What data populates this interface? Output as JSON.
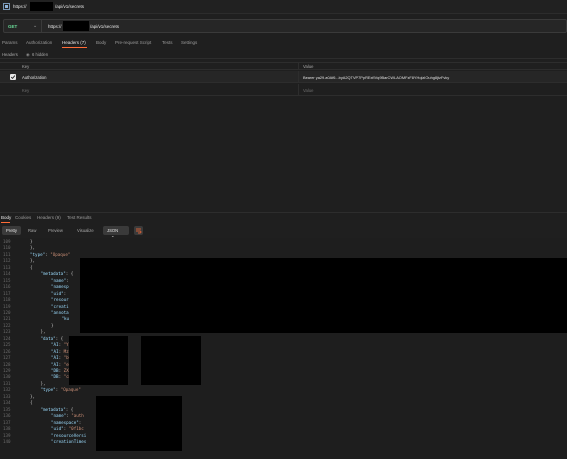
{
  "window": {
    "title_prefix": "https://",
    "title_suffix": "/api/v1/secrets"
  },
  "request": {
    "method": "GET",
    "url_prefix": "https://",
    "url_suffix": "/api/v1/secrets"
  },
  "request_tabs": [
    {
      "label": "Params"
    },
    {
      "label": "Authorization"
    },
    {
      "label": "Headers (7)"
    },
    {
      "label": "Body"
    },
    {
      "label": "Pre-request Script"
    },
    {
      "label": "Tests"
    },
    {
      "label": "Settings"
    }
  ],
  "headers_sub": {
    "label": "Headers",
    "hidden_label": "6 hidden"
  },
  "kv_table": {
    "key_header": "Key",
    "value_header": "Value",
    "rows": [
      {
        "key": "Authorization",
        "value": "Bearer ya29.a0Af6...byA2QTVP7PpRExfIVq9BarCWLAOMFzF8YHqlzIOuhg8jtzFvky"
      }
    ],
    "placeholder_key": "Key",
    "placeholder_value": "Value"
  },
  "response_tabs": [
    {
      "label": "Body"
    },
    {
      "label": "Cookies"
    },
    {
      "label": "Headers (9)"
    },
    {
      "label": "Test Results"
    }
  ],
  "format_tabs": [
    {
      "label": "Pretty"
    },
    {
      "label": "Raw"
    },
    {
      "label": "Preview"
    },
    {
      "label": "Visualize"
    }
  ],
  "format_select": "JSON",
  "code_lines": [
    {
      "n": "109",
      "indent": 0,
      "text": "}"
    },
    {
      "n": "110",
      "indent": 0,
      "text": "},"
    },
    {
      "n": "111",
      "indent": 0,
      "k": "\"type\"",
      "v": "\"Opaque\""
    },
    {
      "n": "112",
      "indent": 0,
      "text": "},"
    },
    {
      "n": "113",
      "indent": 0,
      "text": "{"
    },
    {
      "n": "114",
      "indent": 1,
      "k": "\"metadata\"",
      "text": ": {"
    },
    {
      "n": "115",
      "indent": 2,
      "k": "\"name\"",
      "text": ":"
    },
    {
      "n": "116",
      "indent": 2,
      "k": "\"namesp",
      "text": ""
    },
    {
      "n": "117",
      "indent": 2,
      "k": "\"uid\"",
      "text": ":"
    },
    {
      "n": "118",
      "indent": 2,
      "k": "\"resour",
      "text": ""
    },
    {
      "n": "119",
      "indent": 2,
      "k": "\"creati",
      "text": ""
    },
    {
      "n": "120",
      "indent": 2,
      "k": "\"annota",
      "text": ""
    },
    {
      "n": "121",
      "indent": 3,
      "k": "\"ku",
      "text": ""
    },
    {
      "n": "122",
      "indent": 2,
      "text": "}"
    },
    {
      "n": "123",
      "indent": 1,
      "text": "},"
    },
    {
      "n": "124",
      "indent": 1,
      "k": "\"data\"",
      "text": ": {"
    },
    {
      "n": "125",
      "indent": 2,
      "k": "\"AI",
      "v": "\"Y2"
    },
    {
      "n": "126",
      "indent": 2,
      "k": "\"AI",
      "v": "MzB"
    },
    {
      "n": "127",
      "indent": 2,
      "k": "\"AI",
      "v": "\"bU"
    },
    {
      "n": "128",
      "indent": 2,
      "k": "\"AI",
      "v": "\"eD"
    },
    {
      "n": "129",
      "indent": 2,
      "k": "\"DB",
      "v": "ZXN"
    },
    {
      "n": "130",
      "indent": 2,
      "k": "\"DB",
      "v": "\"cm"
    },
    {
      "n": "131",
      "indent": 1,
      "text": "},"
    },
    {
      "n": "132",
      "indent": 1,
      "k": "\"type\"",
      "v": "\"Opaque\""
    },
    {
      "n": "133",
      "indent": 0,
      "text": "},"
    },
    {
      "n": "134",
      "indent": 0,
      "text": "{"
    },
    {
      "n": "135",
      "indent": 1,
      "k": "\"metadata\"",
      "text": ": {"
    },
    {
      "n": "136",
      "indent": 2,
      "k": "\"name\"",
      "v": "\"auth"
    },
    {
      "n": "137",
      "indent": 2,
      "k": "\"namespace\"",
      "text": ":"
    },
    {
      "n": "138",
      "indent": 2,
      "k": "\"uid\"",
      "v": "\"0f1bc"
    },
    {
      "n": "139",
      "indent": 2,
      "k": "\"resourceVersi",
      "text": ""
    },
    {
      "n": "140",
      "indent": 2,
      "k": "\"creationTimes",
      "text": ""
    }
  ],
  "colors": {
    "accent": "#ff6c37",
    "method_get": "#6bdd9a",
    "json_key": "#9cdcfe",
    "json_string": "#ce9178"
  }
}
